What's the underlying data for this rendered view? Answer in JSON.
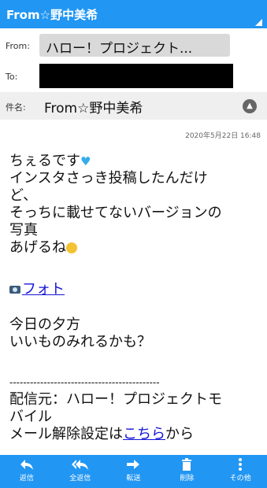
{
  "header": {
    "title": "From☆野中美希"
  },
  "mail": {
    "from_label": "From:",
    "from_value": "ハロー！プロジェクト...",
    "to_label": "To:",
    "subject_label": "件名:",
    "subject_value": "From☆野中美希",
    "date": "2020年5月22日 16:48"
  },
  "body": {
    "l1": "ちぇるです",
    "l2": "インスタさっき投稿したんだけ",
    "l3": "ど、",
    "l4": "そっちに載せてないバージョンの",
    "l5": "写真",
    "l6": "あげるね",
    "photo_link": "フォト",
    "l7": "今日の夕方",
    "l8": "いいものみれるかも？",
    "divider": "--------------------------------------------",
    "l9": "配信元：ハロー！プロジェクトモ",
    "l10": "バイル",
    "unsub_prefix": "メール解除設定は",
    "unsub_link": "こちら",
    "unsub_suffix": "から"
  },
  "toolbar": [
    {
      "label": "返信",
      "icon": "reply-icon"
    },
    {
      "label": "全返信",
      "icon": "reply-all-icon"
    },
    {
      "label": "転送",
      "icon": "forward-icon"
    },
    {
      "label": "削除",
      "icon": "trash-icon"
    },
    {
      "label": "その他",
      "icon": "more-vert-icon"
    }
  ]
}
